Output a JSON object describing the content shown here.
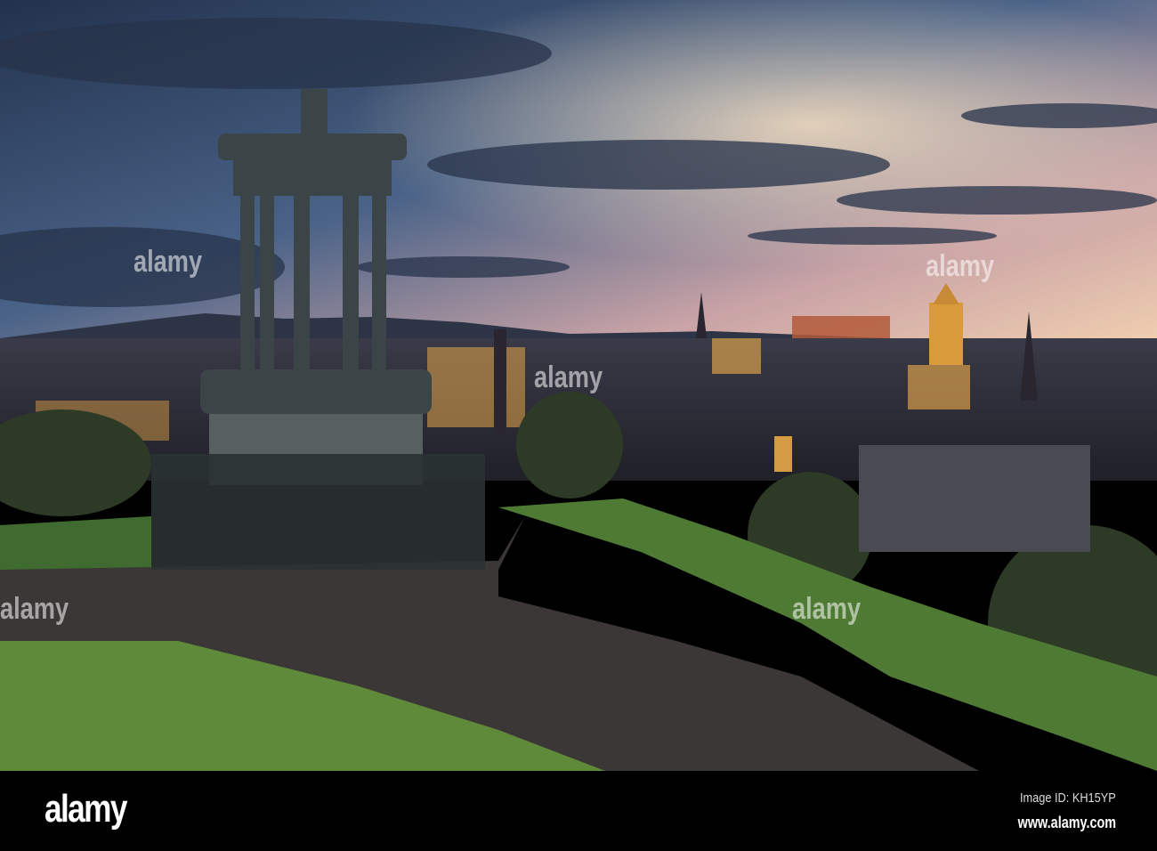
{
  "watermark": {
    "logo": "alamy",
    "image_id": "Image ID: KH15YP",
    "url": "www.alamy.com"
  },
  "colors": {
    "sky_top": "#2b3a55",
    "sky_glow": "#f0c9a8",
    "city_light": "#f5b04a",
    "grass": "#5f8a3a",
    "path": "#3b3736"
  }
}
